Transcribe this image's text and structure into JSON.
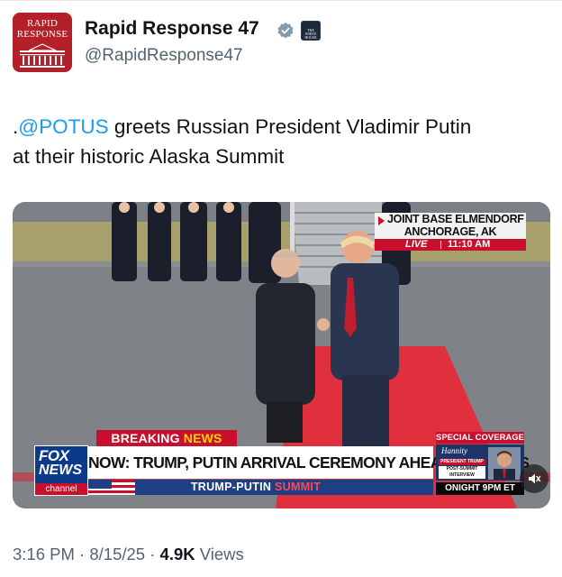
{
  "account": {
    "avatar_text": "RAPID\nRESPONSE",
    "name": "Rapid Response 47",
    "handle": "@RapidResponse47",
    "affiliate_badge_text": "THE WHITE HOUSE"
  },
  "tweet": {
    "prefix": ".",
    "mention": "@POTUS",
    "text_line1_rest": " greets Russian President Vladimir Putin",
    "text_line2": "at their historic Alaska Summit"
  },
  "media": {
    "location_line1": "JOINT BASE ELMENDORF",
    "location_line2": "ANCHORAGE, AK",
    "live_label": "LIVE",
    "live_time": "11:10 AM",
    "breaking_label_white": "BREAKING ",
    "breaking_label_yellow": "NEWS",
    "network_line1": "FOX",
    "network_line2": "NEWS",
    "network_line3": "channel",
    "headline": "NOW: TRUMP, PUTIN ARRIVAL CEREMONY AHEAD OF TALKS",
    "sub_white": "TRUMP-PUTIN ",
    "sub_red": "SUMMIT",
    "special_coverage": "SPECIAL COVERAGE",
    "promo_show": "Hannity",
    "promo_tag": "PRESIDENT TRUMP",
    "promo_line": "POST-SUMMIT INTERVIEW",
    "promo_time": "ONIGHT 9PM ET",
    "mute_icon": "speaker-muted-icon"
  },
  "meta": {
    "time": "3:16 PM",
    "sep1": " · ",
    "date": "8/15/25",
    "sep2": " · ",
    "views_count": "4.9K",
    "views_label": " Views"
  },
  "colors": {
    "link": "#1d9bf0",
    "secondary_text": "#536471",
    "brand_red": "#b3202a",
    "carpet_red": "#e0303e",
    "fox_red": "#c8102e",
    "fox_blue": "#0b3a8a"
  }
}
